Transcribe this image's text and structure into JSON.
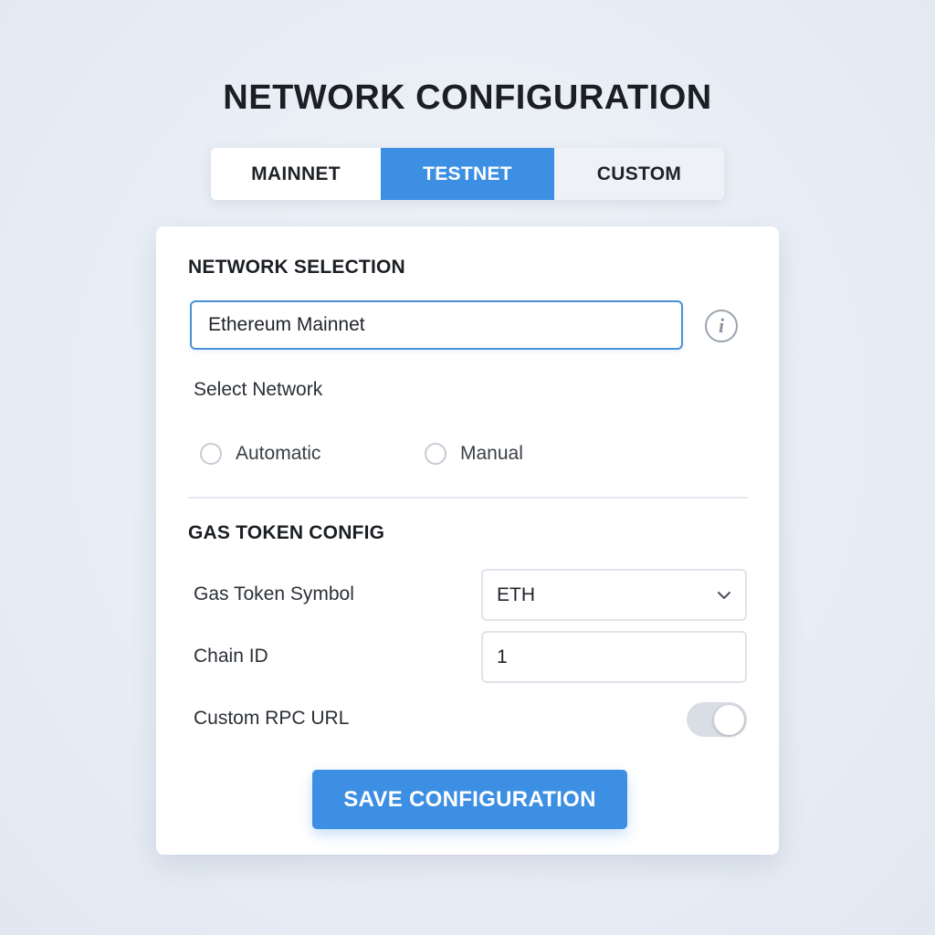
{
  "page": {
    "title": "NETWORK CONFIGURATION"
  },
  "tabs": [
    {
      "label": "MAINNET",
      "active": false
    },
    {
      "label": "TESTNET",
      "active": true
    },
    {
      "label": "CUSTOM",
      "active": false
    }
  ],
  "network_selection": {
    "heading": "NETWORK SELECTION",
    "input_value": "Ethereum Mainnet",
    "info_icon": "info-icon",
    "select_label": "Select Network",
    "options": [
      {
        "label": "Automatic",
        "checked": false
      },
      {
        "label": "Manual",
        "checked": false
      }
    ]
  },
  "gas_token": {
    "heading": "GAS TOKEN CONFIG",
    "symbol_label": "Gas Token Symbol",
    "symbol_value": "ETH",
    "chain_id_label": "Chain ID",
    "chain_id_value": "1",
    "rpc_label": "Custom RPC URL",
    "rpc_enabled": false
  },
  "actions": {
    "save_label": "SAVE CONFIGURATION"
  },
  "colors": {
    "accent": "#3d8fe3",
    "background": "#e6ecf4",
    "card": "#ffffff"
  }
}
